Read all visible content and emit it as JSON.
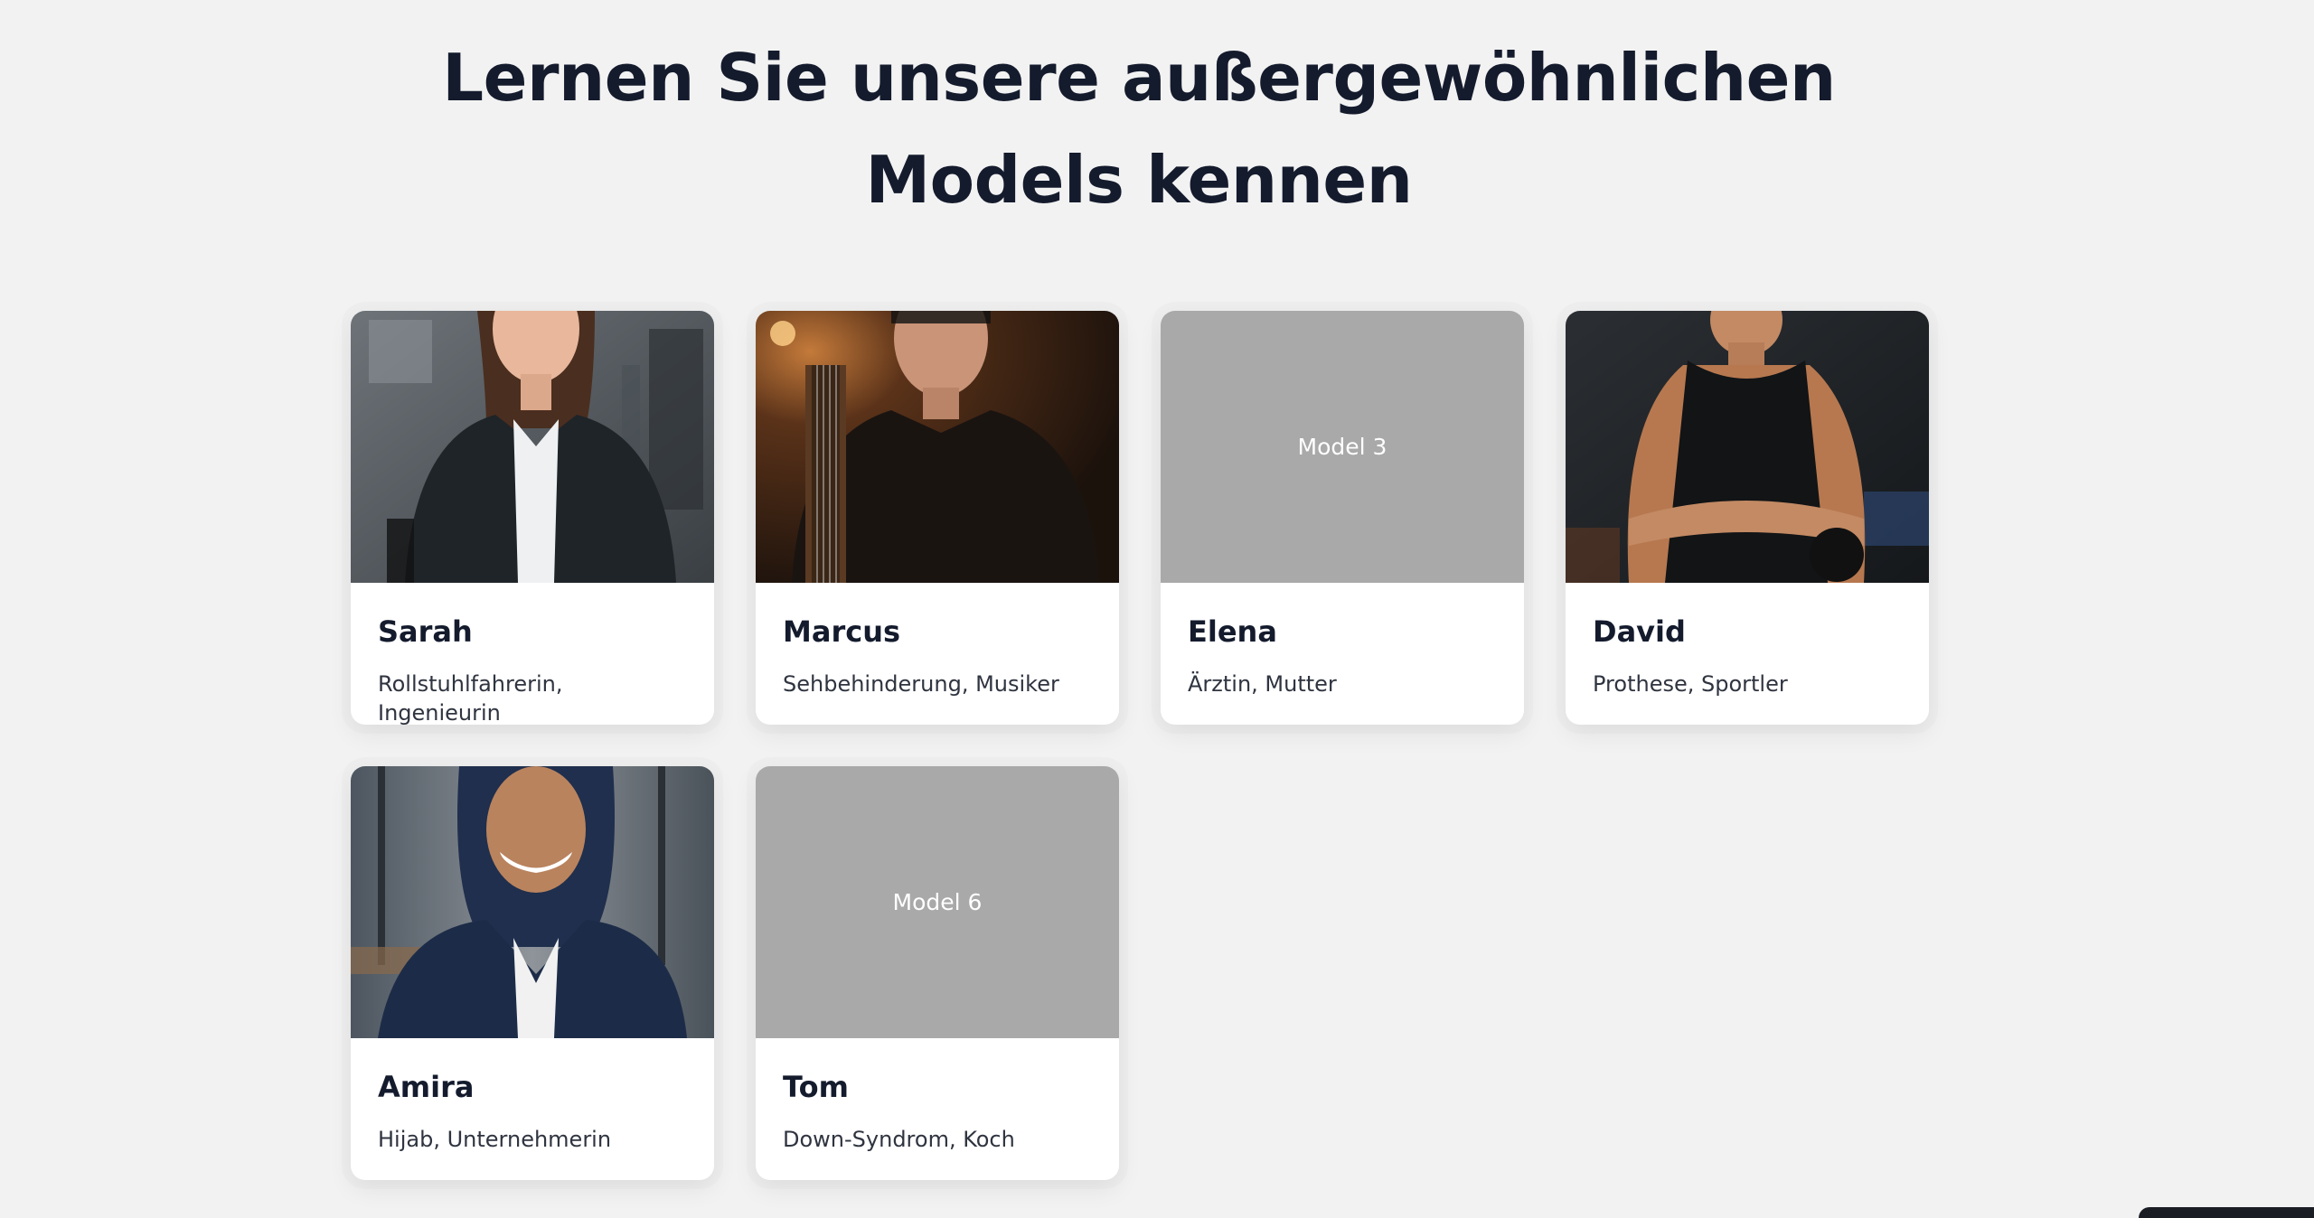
{
  "heading": {
    "line1": "Lernen Sie unsere außergewöhnlichen",
    "line2": "Models kennen"
  },
  "models": [
    {
      "name": "Sarah",
      "description": "Rollstuhlfahrerin, Ingenieurin",
      "image": "photo"
    },
    {
      "name": "Marcus",
      "description": "Sehbehinderung, Musiker",
      "image": "photo"
    },
    {
      "name": "Elena",
      "description": "Ärztin, Mutter",
      "image": "placeholder",
      "placeholder_label": "Model 3"
    },
    {
      "name": "David",
      "description": "Prothese, Sportler",
      "image": "photo"
    },
    {
      "name": "Amira",
      "description": "Hijab, Unternehmerin",
      "image": "photo"
    },
    {
      "name": "Tom",
      "description": "Down-Syndrom, Koch",
      "image": "placeholder",
      "placeholder_label": "Model 6"
    }
  ],
  "colors": {
    "background": "#f2f2f2",
    "heading": "#141b2d",
    "placeholder": "#a9a9a9",
    "card": "#ffffff"
  }
}
